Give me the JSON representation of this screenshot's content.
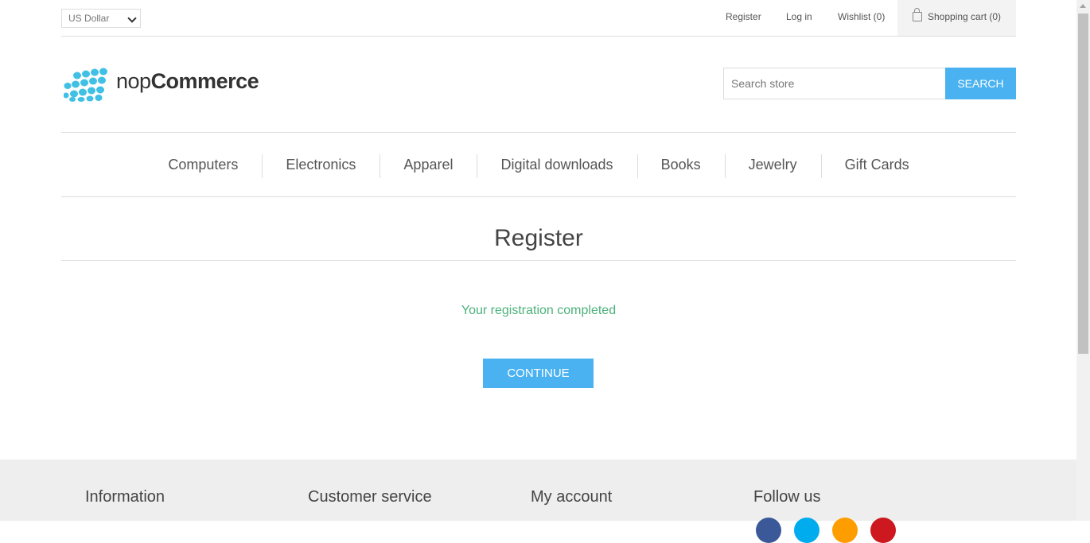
{
  "header": {
    "currency": "US Dollar",
    "links": {
      "register": "Register",
      "login": "Log in",
      "wishlist": "Wishlist (0)",
      "cart": "Shopping cart (0)"
    }
  },
  "logo": {
    "prefix": "nop",
    "suffix": "Commerce"
  },
  "search": {
    "placeholder": "Search store",
    "button": "Search"
  },
  "menu": [
    "Computers",
    "Electronics",
    "Apparel",
    "Digital downloads",
    "Books",
    "Jewelry",
    "Gift Cards"
  ],
  "page": {
    "title": "Register",
    "result": "Your registration completed",
    "continue": "Continue"
  },
  "footer": {
    "columns": [
      "Information",
      "Customer service",
      "My account",
      "Follow us"
    ],
    "social": [
      {
        "name": "facebook-icon",
        "color": "#3b5998"
      },
      {
        "name": "twitter-icon",
        "color": "#00acee"
      },
      {
        "name": "rss-icon",
        "color": "#fe9d00"
      },
      {
        "name": "youtube-icon",
        "color": "#cc181e"
      }
    ]
  },
  "colors": {
    "accent": "#4ab2f1",
    "success": "#4cb17c"
  }
}
